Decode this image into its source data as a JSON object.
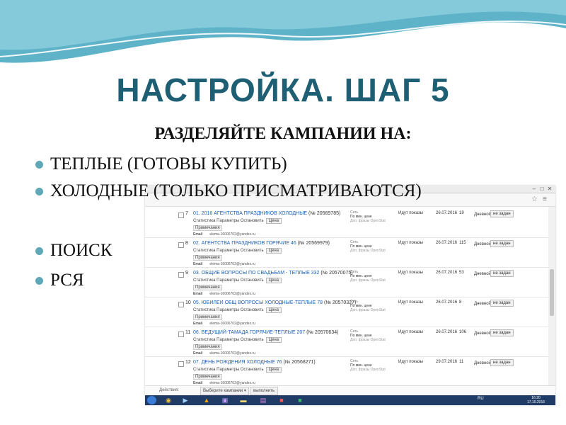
{
  "slide": {
    "title": "НАСТРОЙКА. ШАГ 5",
    "subtitle": "РАЗДЕЛЯЙТЕ КАМПАНИИ НА:",
    "bullets": [
      "ТЕПЛЫЕ (ГОТОВЫ КУПИТЬ)",
      "ХОЛОДНЫЕ (ТОЛЬКО ПРИСМАТРИВАЮТСЯ)",
      "ПОИСК",
      "РСЯ"
    ],
    "colors": {
      "title": "#1f5f73",
      "wave": "#5fb3c8",
      "bullet": "#5fa8b8"
    }
  },
  "window": {
    "controls": [
      "–",
      "□",
      "✕"
    ],
    "icons": [
      "star-icon",
      "menu-icon"
    ]
  },
  "campaigns": [
    {
      "num": "7",
      "name": "01. 2016 АГЕНТСТВА ПРАЗДНИКОВ ХОЛОДНЫЕ",
      "id": "(№ 20569785)",
      "links": "Статистика  Параметры  Остановить",
      "price": "Цена",
      "notes": "Примечания",
      "email_label": "Email",
      "email": "elema-16006702@yandex.ru",
      "net1": "Сеть",
      "net2": "По мин. цене",
      "net3": "Доп. фразы OpenStat",
      "status": "Идут показы",
      "date": "26.07.2016",
      "count": "19",
      "mode": "Дневной",
      "budget": "не задан"
    },
    {
      "num": "8",
      "name": "02. АГЕНТСТВА ПРАЗДНИКОВ ГОРЯЧИЕ 46",
      "id": "(№ 20569979)",
      "links": "Статистика  Параметры  Остановить",
      "price": "Цена",
      "notes": "Примечания",
      "email_label": "Email",
      "email": "elema-16006702@yandex.ru",
      "net1": "Сеть",
      "net2": "По мин. цене",
      "net3": "Доп. фразы OpenStat",
      "status": "Идут показы",
      "date": "26.07.2016",
      "count": "115",
      "mode": "Дневной",
      "budget": "не задан"
    },
    {
      "num": "9",
      "name": "03. ОБЩИЕ ВОПРОСЫ ПО СВАДЬБАМ - ТЕПЛЫЕ 332",
      "id": "(№ 20570075)",
      "links": "Статистика  Параметры  Остановить",
      "price": "Цена",
      "notes": "Примечания",
      "email_label": "Email",
      "email": "elema-16006702@yandex.ru",
      "net1": "Сеть",
      "net2": "По мин. цене",
      "net3": "Доп. фразы OpenStat",
      "status": "Идут показы",
      "date": "26.07.2016",
      "count": "53",
      "mode": "Дневной",
      "budget": "не задан"
    },
    {
      "num": "10",
      "name": "05. ЮБИЛЕИ ОБЩ ВОПРОСЫ ХОЛОДНЫЕ-ТЕПЛЫЕ 78",
      "id": "(№ 20570327)",
      "links": "Статистика  Параметры  Остановить",
      "price": "Цена",
      "notes": "Примечания",
      "email_label": "Email",
      "email": "elema-16006702@yandex.ru",
      "net1": "Сеть",
      "net2": "По мин. цене",
      "net3": "Доп. фразы OpenStat",
      "status": "Идут показы",
      "date": "26.07.2016",
      "count": "8",
      "mode": "Дневной",
      "budget": "не задан"
    },
    {
      "num": "11",
      "name": "06. ВЕДУЩИЙ-ТАМАДА ГОРЯЧИЕ-ТЕПЛЫЕ 207",
      "id": "(№ 20570634)",
      "links": "Статистика  Параметры  Остановить",
      "price": "Цена",
      "notes": "Примечания",
      "email_label": "Email",
      "email": "elema-16006702@yandex.ru",
      "net1": "Сеть",
      "net2": "По мин. цене",
      "net3": "Доп. фразы OpenStat",
      "status": "Идут показы",
      "date": "26.07.2016",
      "count": "106",
      "mode": "Дневной",
      "budget": "не задан"
    },
    {
      "num": "12",
      "name": "07. ДЕНЬ РОЖДЕНИЯ ХОЛОДНЫЕ 76",
      "id": "(№ 20568271)",
      "links": "Статистика  Параметры  Остановить",
      "price": "Цена",
      "notes": "Примечания",
      "email_label": "Email",
      "email": "elema-16006702@yandex.ru",
      "net1": "Сеть",
      "net2": "По мин. цене",
      "net3": "Доп. фразы OpenStat",
      "status": "Идут показы",
      "date": "29.07.2016",
      "count": "11",
      "mode": "Дневной",
      "budget": "не задан"
    }
  ],
  "actions": {
    "label": "Действия:",
    "select": "Выберите кампании ▾",
    "button": "выполнить"
  },
  "taskbar": {
    "apps": [
      "chrome-icon",
      "media-player-icon",
      "avast-icon",
      "winrar-icon",
      "folder-icon",
      "archive-icon",
      "pdf-icon",
      "excel-icon"
    ],
    "lang": "RU",
    "time": "16:20",
    "date": "17.10.2016"
  }
}
